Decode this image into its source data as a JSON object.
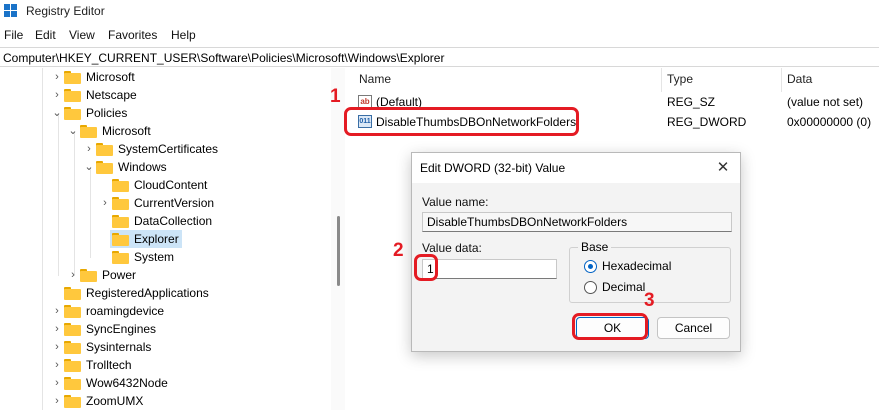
{
  "window": {
    "title": "Registry Editor",
    "icon": "registry-editor-icon"
  },
  "menu": [
    "File",
    "Edit",
    "View",
    "Favorites",
    "Help"
  ],
  "address": "Computer\\HKEY_CURRENT_USER\\Software\\Policies\\Microsoft\\Windows\\Explorer",
  "tree": [
    {
      "label": "Microsoft",
      "level": 0,
      "expander": "collapsed"
    },
    {
      "label": "Netscape",
      "level": 0,
      "expander": "collapsed"
    },
    {
      "label": "Policies",
      "level": 0,
      "expander": "expanded"
    },
    {
      "label": "Microsoft",
      "level": 1,
      "expander": "expanded"
    },
    {
      "label": "SystemCertificates",
      "level": 2,
      "expander": "collapsed"
    },
    {
      "label": "Windows",
      "level": 2,
      "expander": "expanded"
    },
    {
      "label": "CloudContent",
      "level": 3,
      "expander": "none"
    },
    {
      "label": "CurrentVersion",
      "level": 3,
      "expander": "collapsed"
    },
    {
      "label": "DataCollection",
      "level": 3,
      "expander": "none"
    },
    {
      "label": "Explorer",
      "level": 3,
      "expander": "none",
      "selected": true
    },
    {
      "label": "System",
      "level": 3,
      "expander": "none"
    },
    {
      "label": "Power",
      "level": 1,
      "expander": "collapsed"
    },
    {
      "label": "RegisteredApplications",
      "level": 0,
      "expander": "none"
    },
    {
      "label": "roamingdevice",
      "level": 0,
      "expander": "collapsed"
    },
    {
      "label": "SyncEngines",
      "level": 0,
      "expander": "collapsed"
    },
    {
      "label": "Sysinternals",
      "level": 0,
      "expander": "collapsed"
    },
    {
      "label": "Trolltech",
      "level": 0,
      "expander": "collapsed"
    },
    {
      "label": "Wow6432Node",
      "level": 0,
      "expander": "collapsed"
    },
    {
      "label": "ZoomUMX",
      "level": 0,
      "expander": "collapsed"
    }
  ],
  "list": {
    "columns": [
      "Name",
      "Type",
      "Data"
    ],
    "rows": [
      {
        "icon": "string-value-icon",
        "icon_text": "ab",
        "name": "(Default)",
        "type": "REG_SZ",
        "data": "(value not set)"
      },
      {
        "icon": "binary-value-icon",
        "icon_text": "011",
        "name": "DisableThumbsDBOnNetworkFolders",
        "type": "REG_DWORD",
        "data": "0x00000000 (0)"
      }
    ]
  },
  "dialog": {
    "title": "Edit DWORD (32-bit) Value",
    "value_name_label": "Value name:",
    "value_name": "DisableThumbsDBOnNetworkFolders",
    "value_data_label": "Value data:",
    "value_data": "1",
    "base_label": "Base",
    "hex_label": "Hexadecimal",
    "dec_label": "Decimal",
    "base_selected": "Hexadecimal",
    "ok": "OK",
    "cancel": "Cancel",
    "close": "✕"
  },
  "annotations": {
    "step1": "1",
    "step2": "2",
    "step3": "3",
    "color": "#e41b23"
  },
  "colors": {
    "folder": "#ffc83d",
    "selection": "#cce4f7",
    "accent": "#0067c0"
  }
}
